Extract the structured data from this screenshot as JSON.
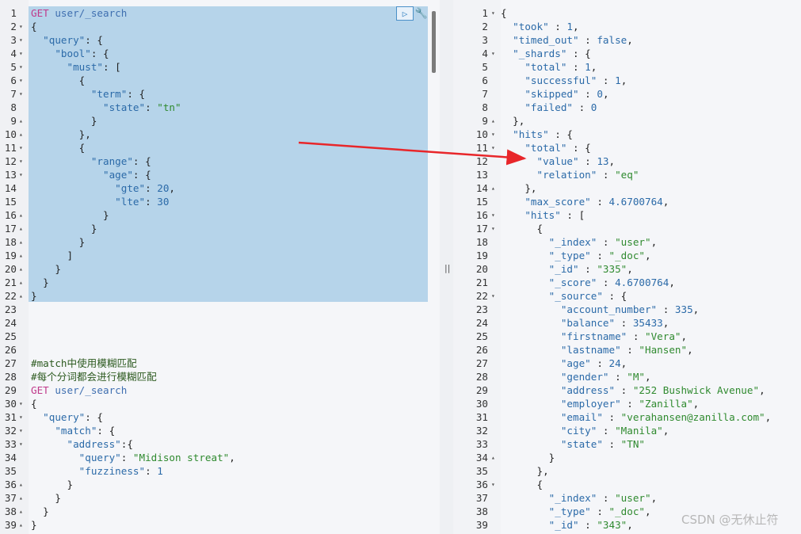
{
  "left_editor": {
    "lines": [
      {
        "n": "1",
        "fold": "",
        "html": "<span class=\"kw\">GET</span> <span class=\"path\">user/_search</span>"
      },
      {
        "n": "2",
        "fold": "▾",
        "html": "{"
      },
      {
        "n": "3",
        "fold": "▾",
        "html": "  <span class=\"k\">\"query\"</span>: {"
      },
      {
        "n": "4",
        "fold": "▾",
        "html": "    <span class=\"k\">\"bool\"</span>: {"
      },
      {
        "n": "5",
        "fold": "▾",
        "html": "      <span class=\"k\">\"must\"</span>: ["
      },
      {
        "n": "6",
        "fold": "▾",
        "html": "        {"
      },
      {
        "n": "7",
        "fold": "▾",
        "html": "          <span class=\"k\">\"term\"</span>: {"
      },
      {
        "n": "8",
        "fold": "",
        "html": "            <span class=\"k\">\"state\"</span>: <span class=\"s\">\"tn\"</span>"
      },
      {
        "n": "9",
        "fold": "▴",
        "html": "          }"
      },
      {
        "n": "10",
        "fold": "▴",
        "html": "        },"
      },
      {
        "n": "11",
        "fold": "▾",
        "html": "        {"
      },
      {
        "n": "12",
        "fold": "▾",
        "html": "          <span class=\"k\">\"range\"</span>: {"
      },
      {
        "n": "13",
        "fold": "▾",
        "html": "            <span class=\"k\">\"age\"</span>: {"
      },
      {
        "n": "14",
        "fold": "",
        "html": "              <span class=\"k\">\"gte\"</span>: <span class=\"n\">20</span>,"
      },
      {
        "n": "15",
        "fold": "",
        "html": "              <span class=\"k\">\"lte\"</span>: <span class=\"n\">30</span>"
      },
      {
        "n": "16",
        "fold": "▴",
        "html": "            }"
      },
      {
        "n": "17",
        "fold": "▴",
        "html": "          }"
      },
      {
        "n": "18",
        "fold": "▴",
        "html": "        }"
      },
      {
        "n": "19",
        "fold": "▴",
        "html": "      ]"
      },
      {
        "n": "20",
        "fold": "▴",
        "html": "    }"
      },
      {
        "n": "21",
        "fold": "▴",
        "html": "  }"
      },
      {
        "n": "22",
        "fold": "▴",
        "html": "}"
      },
      {
        "n": "23",
        "fold": "",
        "html": ""
      },
      {
        "n": "24",
        "fold": "",
        "html": ""
      },
      {
        "n": "25",
        "fold": "",
        "html": ""
      },
      {
        "n": "26",
        "fold": "",
        "html": ""
      },
      {
        "n": "27",
        "fold": "",
        "html": "<span class=\"cm\">#match中使用模糊匹配</span>"
      },
      {
        "n": "28",
        "fold": "",
        "html": "<span class=\"cm\">#每个分词都会进行模糊匹配</span>"
      },
      {
        "n": "29",
        "fold": "",
        "html": "<span class=\"kw\">GET</span> <span class=\"path\">user/_search</span>"
      },
      {
        "n": "30",
        "fold": "▾",
        "html": "{"
      },
      {
        "n": "31",
        "fold": "▾",
        "html": "  <span class=\"k\">\"query\"</span>: {"
      },
      {
        "n": "32",
        "fold": "▾",
        "html": "    <span class=\"k\">\"match\"</span>: {"
      },
      {
        "n": "33",
        "fold": "▾",
        "html": "      <span class=\"k\">\"address\"</span>:{"
      },
      {
        "n": "34",
        "fold": "",
        "html": "        <span class=\"k\">\"query\"</span>: <span class=\"s\">\"Midison streat\"</span>,"
      },
      {
        "n": "35",
        "fold": "",
        "html": "        <span class=\"k\">\"fuzziness\"</span>: <span class=\"n\">1</span>"
      },
      {
        "n": "36",
        "fold": "▴",
        "html": "      }"
      },
      {
        "n": "37",
        "fold": "▴",
        "html": "    }"
      },
      {
        "n": "38",
        "fold": "▴",
        "html": "  }"
      },
      {
        "n": "39",
        "fold": "▴",
        "html": "}"
      }
    ]
  },
  "right_editor": {
    "lines": [
      {
        "n": "1",
        "fold": "▾",
        "html": "{"
      },
      {
        "n": "2",
        "fold": "",
        "html": "  <span class=\"k\">\"took\"</span> : <span class=\"n\">1</span>,"
      },
      {
        "n": "3",
        "fold": "",
        "html": "  <span class=\"k\">\"timed_out\"</span> : <span class=\"n\">false</span>,"
      },
      {
        "n": "4",
        "fold": "▾",
        "html": "  <span class=\"k\">\"_shards\"</span> : {"
      },
      {
        "n": "5",
        "fold": "",
        "html": "    <span class=\"k\">\"total\"</span> : <span class=\"n\">1</span>,"
      },
      {
        "n": "6",
        "fold": "",
        "html": "    <span class=\"k\">\"successful\"</span> : <span class=\"n\">1</span>,"
      },
      {
        "n": "7",
        "fold": "",
        "html": "    <span class=\"k\">\"skipped\"</span> : <span class=\"n\">0</span>,"
      },
      {
        "n": "8",
        "fold": "",
        "html": "    <span class=\"k\">\"failed\"</span> : <span class=\"n\">0</span>"
      },
      {
        "n": "9",
        "fold": "▴",
        "html": "  },"
      },
      {
        "n": "10",
        "fold": "▾",
        "html": "  <span class=\"k\">\"hits\"</span> : {"
      },
      {
        "n": "11",
        "fold": "▾",
        "html": "    <span class=\"k\">\"total\"</span> : {"
      },
      {
        "n": "12",
        "fold": "",
        "html": "      <span class=\"k\">\"value\"</span> : <span class=\"n\">13</span>,"
      },
      {
        "n": "13",
        "fold": "",
        "html": "      <span class=\"k\">\"relation\"</span> : <span class=\"s\">\"eq\"</span>"
      },
      {
        "n": "14",
        "fold": "▴",
        "html": "    },"
      },
      {
        "n": "15",
        "fold": "",
        "html": "    <span class=\"k\">\"max_score\"</span> : <span class=\"n\">4.6700764</span>,"
      },
      {
        "n": "16",
        "fold": "▾",
        "html": "    <span class=\"k\">\"hits\"</span> : ["
      },
      {
        "n": "17",
        "fold": "▾",
        "html": "      {"
      },
      {
        "n": "18",
        "fold": "",
        "html": "        <span class=\"k\">\"_index\"</span> : <span class=\"s\">\"user\"</span>,"
      },
      {
        "n": "19",
        "fold": "",
        "html": "        <span class=\"k\">\"_type\"</span> : <span class=\"s\">\"_doc\"</span>,"
      },
      {
        "n": "20",
        "fold": "",
        "html": "        <span class=\"k\">\"_id\"</span> : <span class=\"s\">\"335\"</span>,"
      },
      {
        "n": "21",
        "fold": "",
        "html": "        <span class=\"k\">\"_score\"</span> : <span class=\"n\">4.6700764</span>,"
      },
      {
        "n": "22",
        "fold": "▾",
        "html": "        <span class=\"k\">\"_source\"</span> : {"
      },
      {
        "n": "23",
        "fold": "",
        "html": "          <span class=\"k\">\"account_number\"</span> : <span class=\"n\">335</span>,"
      },
      {
        "n": "24",
        "fold": "",
        "html": "          <span class=\"k\">\"balance\"</span> : <span class=\"n\">35433</span>,"
      },
      {
        "n": "25",
        "fold": "",
        "html": "          <span class=\"k\">\"firstname\"</span> : <span class=\"s\">\"Vera\"</span>,"
      },
      {
        "n": "26",
        "fold": "",
        "html": "          <span class=\"k\">\"lastname\"</span> : <span class=\"s\">\"Hansen\"</span>,"
      },
      {
        "n": "27",
        "fold": "",
        "html": "          <span class=\"k\">\"age\"</span> : <span class=\"n\">24</span>,"
      },
      {
        "n": "28",
        "fold": "",
        "html": "          <span class=\"k\">\"gender\"</span> : <span class=\"s\">\"M\"</span>,"
      },
      {
        "n": "29",
        "fold": "",
        "html": "          <span class=\"k\">\"address\"</span> : <span class=\"s\">\"252 Bushwick Avenue\"</span>,"
      },
      {
        "n": "30",
        "fold": "",
        "html": "          <span class=\"k\">\"employer\"</span> : <span class=\"s\">\"Zanilla\"</span>,"
      },
      {
        "n": "31",
        "fold": "",
        "html": "          <span class=\"k\">\"email\"</span> : <span class=\"s\">\"verahansen@zanilla.com\"</span>,"
      },
      {
        "n": "32",
        "fold": "",
        "html": "          <span class=\"k\">\"city\"</span> : <span class=\"s\">\"Manila\"</span>,"
      },
      {
        "n": "33",
        "fold": "",
        "html": "          <span class=\"k\">\"state\"</span> : <span class=\"s\">\"TN\"</span>"
      },
      {
        "n": "34",
        "fold": "▴",
        "html": "        }"
      },
      {
        "n": "35",
        "fold": "",
        "html": "      },"
      },
      {
        "n": "36",
        "fold": "▾",
        "html": "      {"
      },
      {
        "n": "37",
        "fold": "",
        "html": "        <span class=\"k\">\"_index\"</span> : <span class=\"s\">\"user\"</span>,"
      },
      {
        "n": "38",
        "fold": "",
        "html": "        <span class=\"k\">\"_type\"</span> : <span class=\"s\">\"_doc\"</span>,"
      },
      {
        "n": "39",
        "fold": "",
        "html": "        <span class=\"k\">\"_id\"</span> : <span class=\"s\">\"343\"</span>,"
      }
    ]
  },
  "toolbar": {
    "run_icon": "play-icon",
    "settings_icon": "wrench-icon"
  },
  "splitter": {
    "handle_glyph": "||"
  },
  "watermark": {
    "text": "CSDN @无休止符"
  },
  "annotation": {
    "arrow_color": "#e8262a"
  }
}
